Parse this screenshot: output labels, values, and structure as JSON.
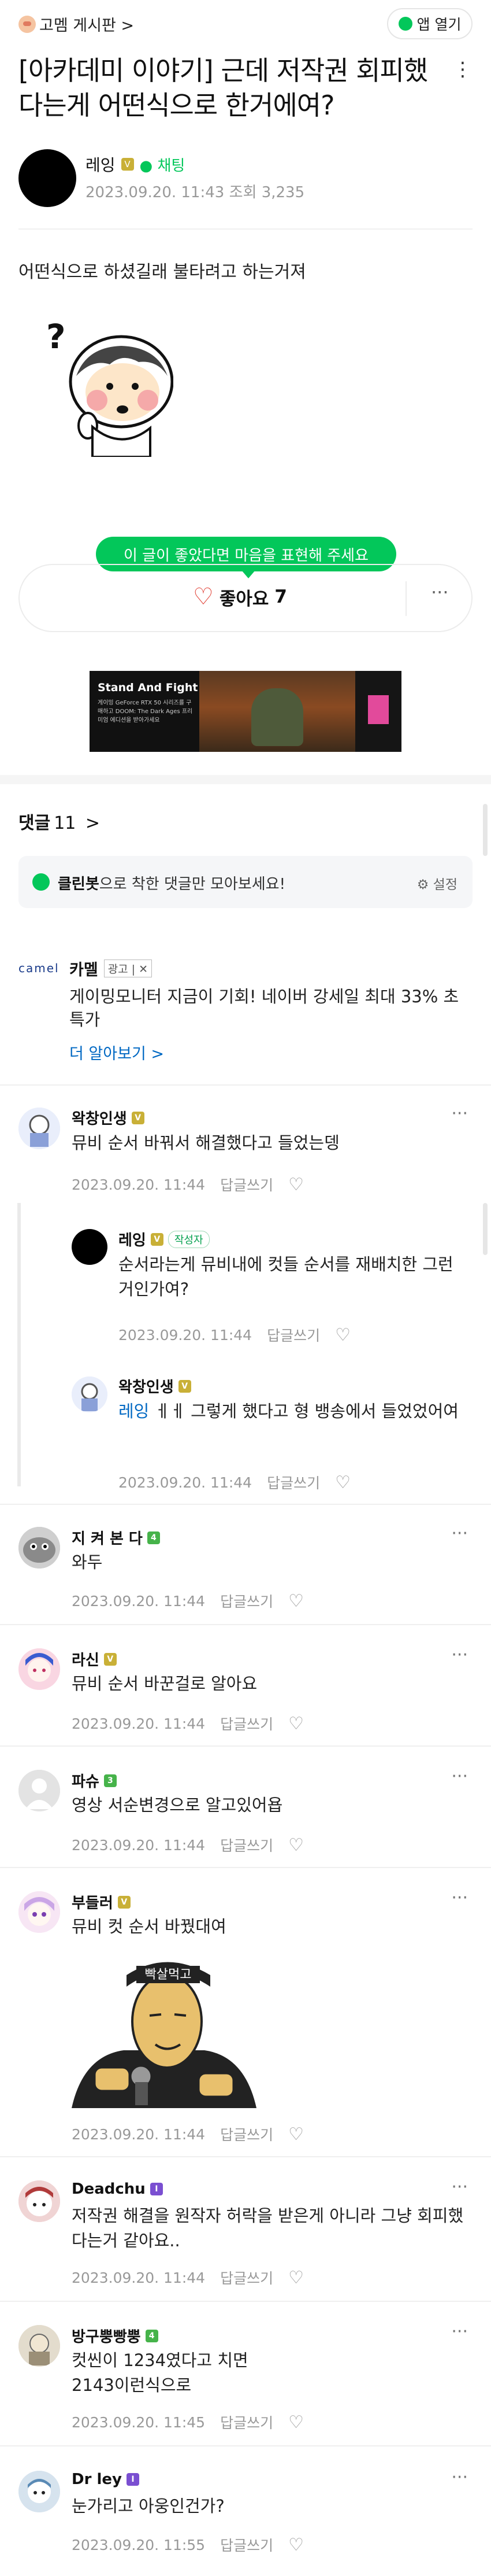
{
  "header": {
    "cafe_name": "고멤 게시판 >",
    "app_button": "앱 열기"
  },
  "post": {
    "title": "[아카데미 이야기] 근데 저작권 회피했다는게 어떤식으로 한거에여?",
    "more": "⋮",
    "author": "레잉",
    "author_badge": "V",
    "chat_label": "채팅",
    "meta": "2023.09.20. 11:43 조회 3,235",
    "body": "어떤식으로 하셨길래 불타려고 하는거져"
  },
  "like": {
    "tooltip": "이 글이 좋았다면 마음을 표현해 주세요",
    "label": "좋아요",
    "count": "7",
    "more": "···"
  },
  "ad_banner": {
    "title": "Stand And Fight",
    "sub": "게이밍 GeForce RTX 50 시리즈를 구매하고 DOOM: The Dark Ages 프리미엄 에디션을 받아가세요"
  },
  "comments_header": {
    "label": "댓글",
    "count": "11",
    "arrow": ">"
  },
  "cleanbot": {
    "brand": "클린봇",
    "text": "으로 착한 댓글만 모아보세요!",
    "settings": "설정"
  },
  "ad2": {
    "brand": "camel",
    "name": "카멜",
    "tag": "광고 | ✕",
    "text": "게이밍모니터 지금이 기회! 네이버 강세일 최대 33% 초특가",
    "link": "더 알아보기 >"
  },
  "comment_actions": {
    "reply": "답글쓰기",
    "more": "···"
  },
  "comments": [
    {
      "name": "왁창인생",
      "level": "V",
      "text": "뮤비 순서 바꿔서 해결했다고 들었는뎅",
      "time": "2023.09.20. 11:44"
    },
    {
      "name": "레잉",
      "level": "V",
      "writer": "작성자",
      "text": "순서라는게 뮤비내에 컷들 순서를 재배치한 그런거인가여?",
      "time": "2023.09.20. 11:44"
    },
    {
      "name": "왁창인생",
      "level": "V",
      "mention": "레잉",
      "text": " ㅔㅔ 그렇게 했다고 형 뱅송에서 들었었어여",
      "time": "2023.09.20. 11:44"
    },
    {
      "name": "지 켜 본 다",
      "level": "4",
      "text": "와두",
      "time": "2023.09.20. 11:44"
    },
    {
      "name": "라신",
      "level": "V",
      "text": "뮤비 순서 바꾼걸로 알아요",
      "time": "2023.09.20. 11:44"
    },
    {
      "name": "파슈",
      "level": "3",
      "text": "영상 서순변경으로 알고있어욥",
      "time": "2023.09.20. 11:44"
    },
    {
      "name": "부들러",
      "level": "V",
      "text": "뮤비 컷 순서 바꿨대여",
      "sticker_text": "빡살먹고",
      "time": "2023.09.20. 11:44"
    },
    {
      "name": "Deadchu",
      "level": "I",
      "text": "저작권 해결을 원작자 허락을 받은게 아니라 그냥 회피했다는거 같아요..",
      "time": "2023.09.20. 11:44"
    },
    {
      "name": "방구뿡빵뿡",
      "level": "4",
      "text": "컷씬이 1234였다고 치면\n2143이런식으로",
      "time": "2023.09.20. 11:45"
    },
    {
      "name": "Dr ley",
      "level": "I",
      "text": "눈가리고 아웅인건가?",
      "time": "2023.09.20. 11:55"
    }
  ]
}
